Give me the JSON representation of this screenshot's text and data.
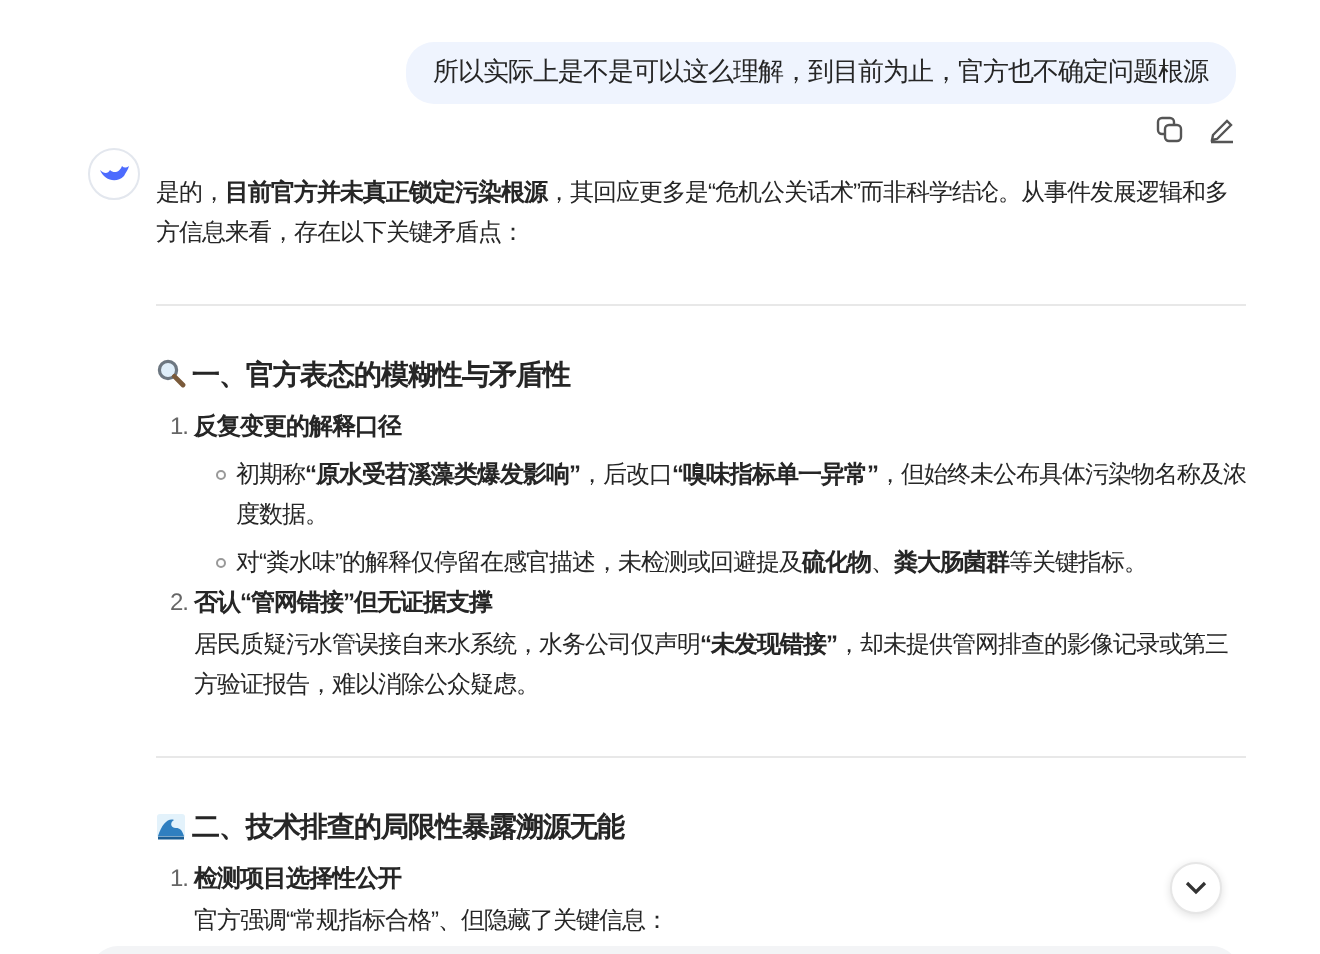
{
  "user_message": {
    "text": "所以实际上是不是可以这么理解，到目前为止，官方也不确定问题根源"
  },
  "answer": {
    "intro": "是的，**目前官方并未真正锁定污染根源**，其回应更多是“危机公关话术”而非科学结论。从事件发展逻辑和多方信息来看，存在以下关键矛盾点：",
    "sections": [
      {
        "heading": "一、官方表态的模糊性与矛盾性",
        "items": [
          {
            "number": "1.",
            "title": "反复变更的解释口径",
            "bullets": [
              "初期称**“原水受苕溪藻类爆发影响”**，后改口**“嗅味指标单一异常”**，但始终未公布具体污染物名称及浓度数据。",
              "对“粪水味”的解释仅停留在感官描述，未检测或回避提及**硫化物**、**粪大肠菌群**等关键指标。"
            ]
          },
          {
            "number": "2.",
            "title": "否认“管网错接”但无证据支撑",
            "body": "居民质疑污水管误接自来水系统，水务公司仅声明**“未发现错接”**，却未提供管网排查的影像记录或第三方验证报告，难以消除公众疑虑。"
          }
        ]
      },
      {
        "heading": "二、技术排查的局限性暴露溯源无能",
        "items": [
          {
            "number": "1.",
            "title": "检测项目选择性公开",
            "body": "官方强调“常规指标合格”、但隐藏了关键信息："
          }
        ]
      }
    ]
  }
}
